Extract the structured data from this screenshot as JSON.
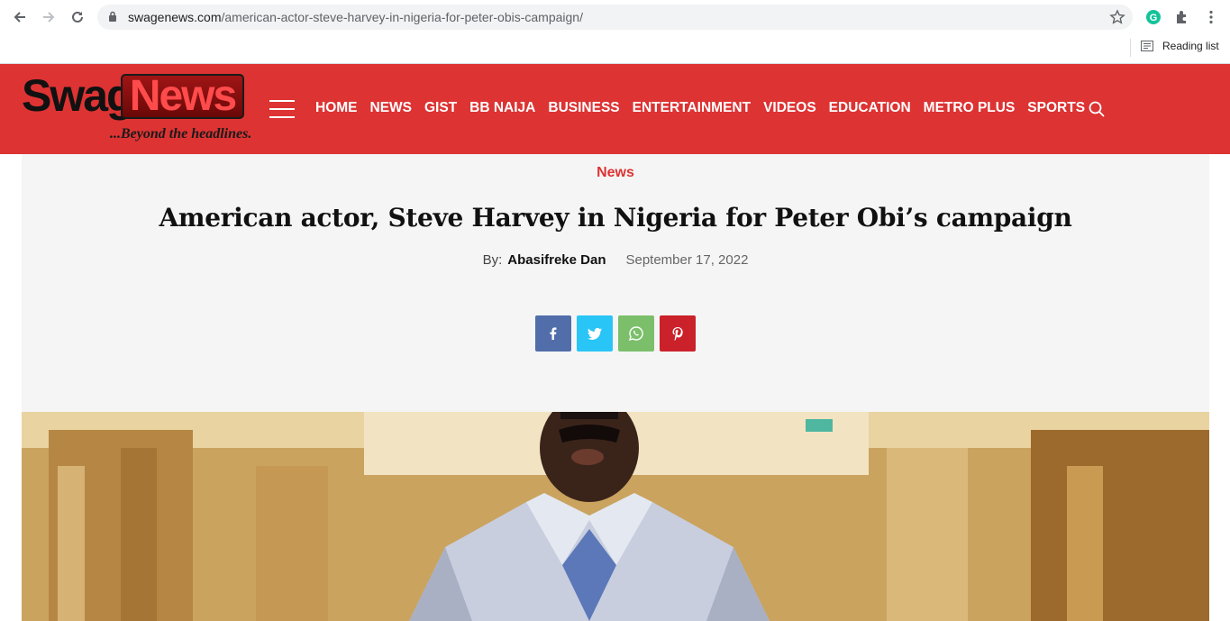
{
  "browser": {
    "url_domain": "swagenews.com",
    "url_path": "/american-actor-steve-harvey-in-nigeria-for-peter-obis-campaign/",
    "reading_list_label": "Reading list"
  },
  "site": {
    "logo_word1": "Swage",
    "logo_word2": "News",
    "tagline": "...Beyond the headlines.",
    "brand_color": "#dd3333"
  },
  "menu": {
    "items": [
      {
        "label": "HOME"
      },
      {
        "label": "NEWS"
      },
      {
        "label": "GIST"
      },
      {
        "label": "BB NAIJA"
      },
      {
        "label": "BUSINESS"
      },
      {
        "label": "ENTERTAINMENT"
      },
      {
        "label": "VIDEOS"
      },
      {
        "label": "EDUCATION"
      },
      {
        "label": "METRO PLUS"
      },
      {
        "label": "SPORTS"
      }
    ]
  },
  "article": {
    "category": "News",
    "title": "American actor, Steve Harvey in Nigeria for Peter Obi’s campaign",
    "by_label": "By:",
    "author": "Abasifreke Dan",
    "date": "September 17, 2022"
  },
  "share": {
    "icons": [
      "facebook-icon",
      "twitter-icon",
      "whatsapp-icon",
      "pinterest-icon"
    ]
  }
}
